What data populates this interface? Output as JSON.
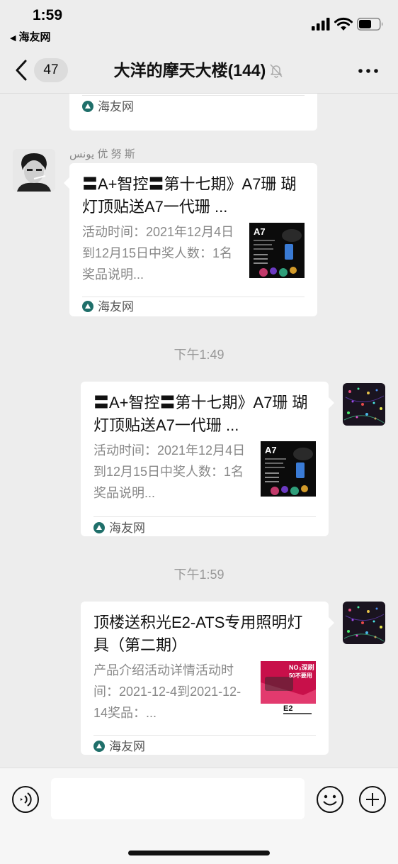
{
  "status_bar": {
    "time": "1:59",
    "back_app": "海友网"
  },
  "nav": {
    "unread_count": "47",
    "title": "大洋的摩天大楼(144)"
  },
  "messages": {
    "top_card": {
      "source": "海友网"
    },
    "msg1": {
      "sender": "يونس  优 努 斯",
      "title": "〓A+智控〓第十七期》A7珊 瑚灯顶贴送A7一代珊 ...",
      "desc": "活动时间：2021年12月4日到12月15日中奖人数：1名奖品说明...",
      "thumb_text": "A7",
      "source": "海友网"
    },
    "time1": "下午1:49",
    "msg2": {
      "title": "〓A+智控〓第十七期》A7珊 瑚灯顶贴送A7一代珊 ...",
      "desc": "活动时间：2021年12月4日到12月15日中奖人数：1名奖品说明...",
      "thumb_text": "A7",
      "source": "海友网"
    },
    "time2": "下午1:59",
    "msg3": {
      "title": "顶楼送积光E2-ATS专用照明灯具（第二期）",
      "desc": "产品介绍活动详情活动时间：2021-12-4到2021-12-14奖品：...",
      "thumb_line1": "NO₃深刷",
      "thumb_line2": "50不要用",
      "thumb_brand": "E2",
      "source": "海友网"
    }
  },
  "colors": {
    "background": "#ededed",
    "card": "#ffffff",
    "desc_text": "#888888",
    "timestamp": "#999999"
  }
}
